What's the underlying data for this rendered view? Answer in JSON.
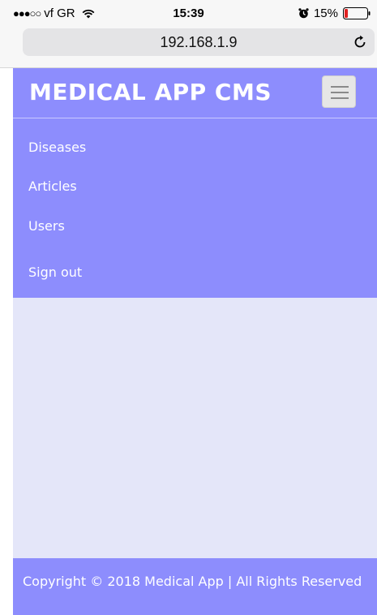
{
  "status_bar": {
    "signal": "●●●○○",
    "carrier": "vf GR",
    "time": "15:39",
    "battery": "15%",
    "icons": {
      "wifi": "wifi-icon",
      "alarm": "alarm-icon",
      "battery": "battery-icon"
    },
    "battery_level": 0.15,
    "battery_color": "#e02020"
  },
  "browser": {
    "url": "192.168.1.9",
    "reload_icon": "reload-icon"
  },
  "app": {
    "brand": "MEDICAL APP CMS",
    "menu_icon": "hamburger-menu-icon",
    "nav": {
      "items": [
        {
          "label": "Diseases"
        },
        {
          "label": "Articles"
        },
        {
          "label": "Users"
        },
        {
          "label": "Sign out"
        }
      ]
    },
    "footer": {
      "text": "Copyright © 2018 Medical App | All Rights Reserved"
    },
    "colors": {
      "accent": "#8d8dfd",
      "background": "#e4e6f9",
      "text": "#ffffff"
    }
  }
}
